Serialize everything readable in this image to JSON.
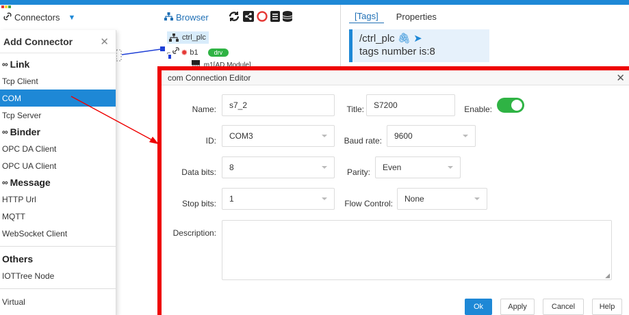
{
  "toolbar": {
    "connectors_label": "Connectors",
    "browser_label": "Browser"
  },
  "tree": {
    "root_label": "ctrl_plc",
    "node_label": "b1",
    "node_badge": "drv",
    "child_label": "m1[AD Module]"
  },
  "right_panel": {
    "tabs": [
      {
        "label": "[Tags]",
        "active": true
      },
      {
        "label": "Properties",
        "active": false
      }
    ],
    "path": "/ctrl_plc",
    "tags_text": "tags number is:8"
  },
  "dropdown": {
    "title": "Add Connector",
    "groups": [
      {
        "label": "Link",
        "items": [
          "Tcp Client",
          "COM",
          "Tcp Server"
        ]
      },
      {
        "label": "Binder",
        "items": [
          "OPC DA Client",
          "OPC UA Client"
        ]
      },
      {
        "label": "Message",
        "items": [
          "HTTP Url",
          "MQTT",
          "WebSocket Client"
        ]
      }
    ],
    "others_label": "Others",
    "others_items": [
      "IOTTree Node"
    ],
    "virtual_label": "Virtual",
    "selected": "COM"
  },
  "editor": {
    "title": "com Connection Editor",
    "name_label": "Name:",
    "name_value": "s7_2",
    "title_label": "Title:",
    "title_value": "S7200",
    "enable_label": "Enable:",
    "enable_on": true,
    "id_label": "ID:",
    "id_value": "COM3",
    "baud_label": "Baud rate:",
    "baud_value": "9600",
    "databits_label": "Data bits:",
    "databits_value": "8",
    "parity_label": "Parity:",
    "parity_value": "Even",
    "stopbits_label": "Stop bits:",
    "stopbits_value": "1",
    "flow_label": "Flow Control:",
    "flow_value": "None",
    "desc_label": "Description:",
    "desc_value": "",
    "buttons": {
      "ok": "Ok",
      "apply": "Apply",
      "cancel": "Cancel",
      "help": "Help"
    }
  },
  "colors": {
    "accent": "#1e88d6",
    "highlight_border": "#e00000",
    "toggle_on": "#2fb344"
  }
}
